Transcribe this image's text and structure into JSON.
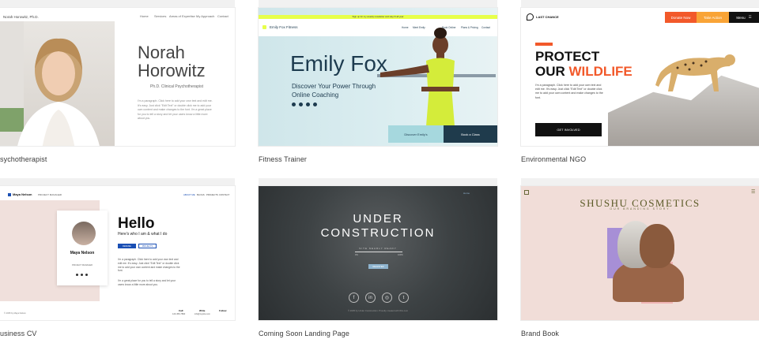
{
  "templates": [
    {
      "caption": "sychotherapist",
      "brand": "Norah Horowitz, Ph.D.",
      "nav": [
        "Home",
        "Services",
        "Areas of Expertise",
        "My Approach",
        "Contact"
      ],
      "first_name": "Norah",
      "last_name": "Horowitz",
      "subtitle": "Ph.D. Clinical Psychotherapist",
      "paragraph": "I'm a paragraph. Click here to add your own text and edit me. It's easy. Just click \"Edit Text\" or double click me to add your own content and make changes to the font. I'm a great place for you to tell a story and let your users know a little more about you."
    },
    {
      "caption": "Fitness Trainer",
      "banner": "Sign up for my weekly newsletter and stay fit all year",
      "brand": "Emily Fox Fitness",
      "nav": [
        "Home",
        "Meet Emily",
        "Book Online",
        "Plans & Pricing",
        "Contact"
      ],
      "name": "Emily Fox",
      "subtitle": "Discover Your Power Through Online Coaching",
      "cta_primary": "Discover Emily's",
      "cta_secondary": "Book a Class"
    },
    {
      "caption": "Environmental NGO",
      "brand": "LAST CHANCE",
      "donate": "Donate Now",
      "take_action": "Take Action",
      "menu": "Menu",
      "headline_1": "PROTECT",
      "headline_2a": "OUR ",
      "headline_2b": "WILDLIFE",
      "paragraph": "I'm a paragraph. Click here to add your own text and edit me. It's easy. Just click \"Edit Text\" or double click me to add your own content and make changes to the font.",
      "cta": "GET INVOLVED"
    },
    {
      "caption": "usiness CV",
      "brand": "Maya Nelson",
      "role_tag": "PROJECT MANAGER",
      "nav": [
        "ABOUT ME",
        "BLOGS",
        "PROJECTS",
        "CONTACT"
      ],
      "card_name": "Maya Nelson",
      "card_role": "PROJECT MANAGER",
      "hello": "Hello",
      "sub": "Here's who I am & what I do",
      "btn_resume": "RESUME",
      "btn_projects": "PROJECTS",
      "paragraph": "I'm a paragraph. Click here to add your own text and edit me. It's easy. Just click \"Edit Text\" or double click me to add your own content and make changes to the font.",
      "paragraph2": "I'm a great place for you to tell a story and let your users know a little more about you.",
      "footer": [
        {
          "label": "Call",
          "value": "123-456-7890"
        },
        {
          "label": "Write",
          "value": "info@mysite.com"
        },
        {
          "label": "Follow",
          "value": ""
        }
      ],
      "copyright": "© 2035 by Maya Nelson"
    },
    {
      "caption": "Coming Soon Landing Page",
      "top_link": "Home",
      "title_1": "UNDER",
      "title_2": "CONSTRUCTION",
      "tagline": "SITE NEARLY READY",
      "percent_left": "0%",
      "percent_right": "100%",
      "cta": "REGISTER",
      "socials": [
        "f",
        "in",
        "◎",
        "t"
      ],
      "footer": "© 2035 by Under Construction. Proudly created with Wix.com"
    },
    {
      "caption": "Brand Book",
      "title": "SHUSHU COSMETICS",
      "subtitle": "OUR BRANDING STORY"
    }
  ],
  "colors": {
    "accent_orange": "#f2592a",
    "emily_yellow": "#e7ff4a",
    "emily_navy": "#1f3b4c",
    "maya_blue": "#1a4fb4",
    "shushu_olive": "#5b5a26"
  }
}
